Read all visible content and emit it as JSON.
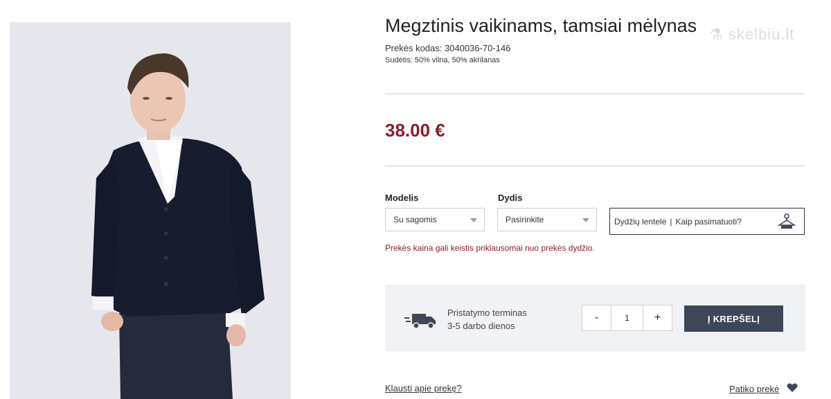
{
  "watermark": "⚗ skelbiu.lt",
  "product": {
    "title": "Megztinis vaikinams, tamsiai mėlynas",
    "code": "Prekės kodas: 3040036-70-146",
    "composition": "Sudėtis: 50% vilna, 50% akrilanas",
    "price": "38.00 €"
  },
  "options": {
    "model_label": "Modelis",
    "model_value": "Su sagomis",
    "size_label": "Dydis",
    "size_value": "Pasirinkite",
    "size_table": "Dydžių lentelė",
    "separator": "|",
    "how_to_measure": "Kaip pasimatuoti?",
    "note": "Prekės kaina gali keistis priklausomai nuo prekės dydžio."
  },
  "delivery": {
    "title": "Pristatymo terminas",
    "days": "3-5 darbo dienos"
  },
  "quantity": {
    "minus": "-",
    "value": "1",
    "plus": "+"
  },
  "cart_button": "Į KREPŠELĮ",
  "footer": {
    "ask": "Klausti apie prekę?",
    "like": "Patiko prekė"
  },
  "colors": {
    "price": "#8b1d2b",
    "cart_bg": "#3d4757",
    "panel_bg": "#f0f2f5"
  },
  "icons": [
    "truck-icon",
    "hanger-icon",
    "heart-icon",
    "chevron-down-icon"
  ]
}
